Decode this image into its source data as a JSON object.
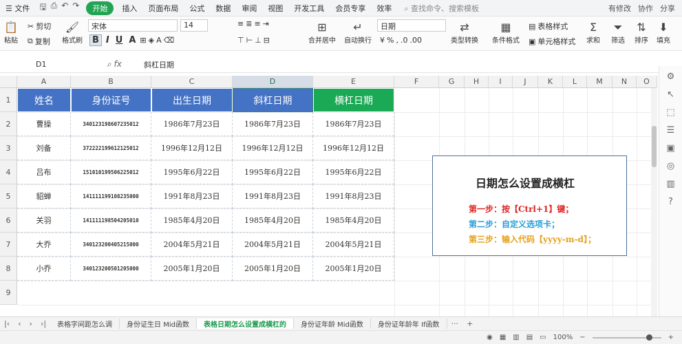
{
  "menu": {
    "file": "文件",
    "quick_icons": [
      "save-icon",
      "print-icon",
      "undo-icon",
      "redo-icon"
    ],
    "items": [
      "开始",
      "插入",
      "页面布局",
      "公式",
      "数据",
      "审阅",
      "视图",
      "开发工具",
      "会员专享",
      "效率"
    ],
    "active_index": 0,
    "search": "查找命令、搜索模板",
    "right": [
      "有修改",
      "协作",
      "分享"
    ]
  },
  "toolbar": {
    "paste": "粘贴",
    "cut": "剪切",
    "copy": "复制",
    "format_painter": "格式刷",
    "font_name": "宋体",
    "font_size": "14",
    "bold": "B",
    "italic": "I",
    "underline": "U",
    "merge": "合并居中",
    "wrap": "自动换行",
    "number_format": "日期",
    "type_convert": "类型转换",
    "cond_format": "条件格式",
    "table_style": "表格样式",
    "cell_style": "单元格样式",
    "sum": "求和",
    "filter": "筛选",
    "sort": "排序",
    "fill": "填充"
  },
  "formula_bar": {
    "name_box": "D1",
    "formula": "斜杠日期"
  },
  "sheet": {
    "columns": [
      "A",
      "B",
      "C",
      "D",
      "E",
      "F",
      "G",
      "H",
      "I",
      "J",
      "K",
      "L",
      "M",
      "N",
      "O"
    ],
    "selected_column": "D",
    "rows": [
      "1",
      "2",
      "3",
      "4",
      "5",
      "6",
      "7",
      "8",
      "9"
    ],
    "headers": [
      "姓名",
      "身份证号",
      "出生日期",
      "斜杠日期",
      "横杠日期"
    ],
    "data": [
      [
        "曹操",
        "340123198607235012",
        "1986年7月23日",
        "1986年7月23日",
        "1986年7月23日"
      ],
      [
        "刘备",
        "372222199612125012",
        "1996年12月12日",
        "1996年12月12日",
        "1996年12月12日"
      ],
      [
        "吕布",
        "151010199506225012",
        "1995年6月22日",
        "1995年6月22日",
        "1995年6月22日"
      ],
      [
        "貂蝉",
        "141111199108235000",
        "1991年8月23日",
        "1991年8月23日",
        "1991年8月23日"
      ],
      [
        "关羽",
        "141111198504205010",
        "1985年4月20日",
        "1985年4月20日",
        "1985年4月20日"
      ],
      [
        "大乔",
        "340123200405215000",
        "2004年5月21日",
        "2004年5月21日",
        "2004年5月21日"
      ],
      [
        "小乔",
        "340123200501205000",
        "2005年1月20日",
        "2005年1月20日",
        "2005年1月20日"
      ]
    ]
  },
  "note": {
    "title": "日期怎么设置成横杠",
    "step1": "第一步：按【Ctrl+1】键；",
    "step2": "第二步：自定义选项卡；",
    "step3": "第三步：输入代码【yyyy-m-d】；",
    "colors": {
      "step1": "#e02424",
      "step2": "#2a9fd6",
      "step3": "#e5a11b"
    }
  },
  "tabs": {
    "items": [
      "表格字间距怎么调",
      "身份证生日 Mid函数",
      "表格日期怎么设置成横杠的",
      "身份证年龄 Mid函数",
      "身份证年龄年 If函数"
    ],
    "active_index": 2,
    "more": "···",
    "add": "+"
  },
  "status": {
    "zoom": "100%",
    "zoom_minus": "−",
    "zoom_plus": "+"
  },
  "colors": {
    "header_blue": "#4472c4",
    "header_green": "#1aaa55",
    "accent": "#23a455"
  }
}
